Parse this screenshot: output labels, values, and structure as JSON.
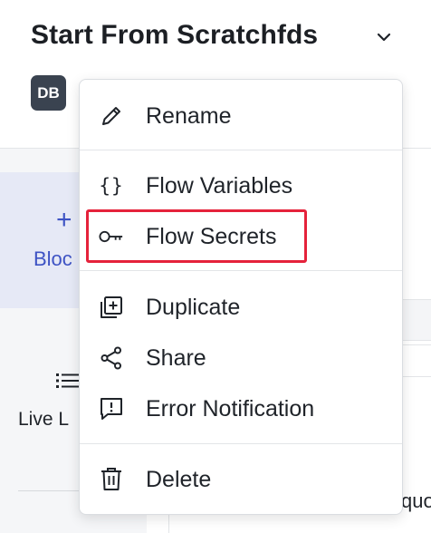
{
  "header": {
    "title": "Start From Scratchfds",
    "chevron_icon": "chevron-down-icon",
    "avatar_initials": "DB"
  },
  "background": {
    "blocks_plus": "+",
    "blocks_label": "Bloc",
    "live_label": "Live L",
    "partial_right_text": "quo"
  },
  "menu": {
    "items": [
      {
        "label": "Rename",
        "icon": "pencil-icon"
      },
      {
        "label": "Flow Variables",
        "icon": "braces-icon",
        "icon_text": "{}"
      },
      {
        "label": "Flow Secrets",
        "icon": "key-icon",
        "highlighted": true
      },
      {
        "label": "Duplicate",
        "icon": "duplicate-icon"
      },
      {
        "label": "Share",
        "icon": "share-icon"
      },
      {
        "label": "Error Notification",
        "icon": "error-notification-icon"
      },
      {
        "label": "Delete",
        "icon": "trash-icon"
      }
    ]
  },
  "colors": {
    "highlight": "#e5223b",
    "accent": "#3e53c4",
    "avatar_bg": "#3a4350"
  }
}
